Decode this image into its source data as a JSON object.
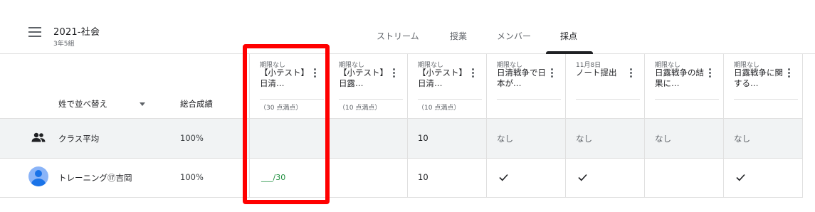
{
  "header": {
    "class_title": "2021-社会",
    "class_subtitle": "3年5組",
    "tabs": [
      {
        "label": "ストリーム"
      },
      {
        "label": "授業"
      },
      {
        "label": "メンバー"
      },
      {
        "label": "採点"
      }
    ],
    "active_tab": "採点"
  },
  "grid": {
    "sort_label": "姓で並べ替え",
    "total_header": "総合成績",
    "assignments": [
      {
        "due": "期限なし",
        "title": "【小テスト】日清…",
        "points": "（30 点満点）"
      },
      {
        "due": "期限なし",
        "title": "【小テスト】日露…",
        "points": "（10 点満点）"
      },
      {
        "due": "期限なし",
        "title": "【小テスト】日清…",
        "points": "（10 点満点）"
      },
      {
        "due": "期限なし",
        "title": "日清戦争で日本が…",
        "points": ""
      },
      {
        "due": "11月8日",
        "title": "ノート提出",
        "points": ""
      },
      {
        "due": "期限なし",
        "title": "日露戦争の結果に…",
        "points": ""
      },
      {
        "due": "期限なし",
        "title": "日露戦争に関する…",
        "points": ""
      }
    ],
    "class_average": {
      "label": "クラス平均",
      "total": "100%",
      "cells": [
        "",
        "",
        "10",
        "なし",
        "なし",
        "なし",
        "なし"
      ]
    },
    "student": {
      "name": "トレーニング⑰吉岡",
      "total": "100%",
      "score_entry": "___/30",
      "cells": [
        "",
        "",
        "10",
        "✓",
        "✓",
        "",
        "✓"
      ]
    }
  },
  "colors": {
    "highlight": "#ff0000",
    "score_green": "#1e8e3e",
    "avatar_blue": "#1a73e8"
  }
}
